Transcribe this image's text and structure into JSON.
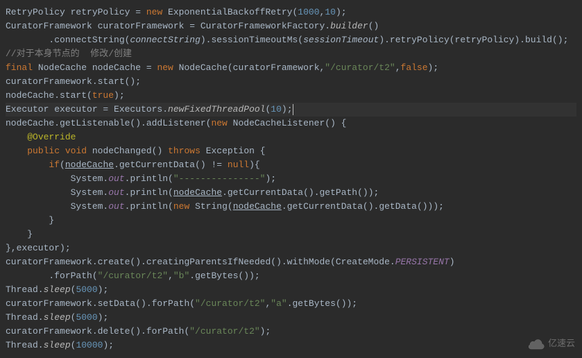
{
  "code": {
    "l1": {
      "t1": "RetryPolicy retryPolicy = ",
      "kw_new": "new",
      "t2": " ExponentialBackoffRetry(",
      "n1": "1000",
      "comma": ",",
      "n2": "10",
      "t3": ");"
    },
    "l2": {
      "t1": "CuratorFramework curatorFramework = CuratorFrameworkFactory.",
      "m1": "builder",
      "t2": "()"
    },
    "l3": {
      "indent": "        ",
      "t1": ".connectString(",
      "p1": "connectString",
      "t2": ").sessionTimeoutMs(",
      "p2": "sessionTimeout",
      "t3": ").retryPolicy(retryPolicy).build();"
    },
    "l4": {
      "c": "//对于本身节点的  修改/创建"
    },
    "l5": {
      "kw_final": "final",
      "t1": " NodeCache nodeCache = ",
      "kw_new": "new",
      "t2": " NodeCache(curatorFramework,",
      "s1": "\"/curator/t2\"",
      "t3": ",",
      "kw_false": "false",
      "t4": ");"
    },
    "l6": {
      "t1": "curatorFramework.start();"
    },
    "l7": {
      "t1": "nodeCache.start(",
      "kw_true": "true",
      "t2": ");"
    },
    "l8": {
      "t1": "Executor executor = Executors.",
      "m1": "newFixedThreadPool",
      "t2": "(",
      "n1": "10",
      "t3": ");"
    },
    "l9": {
      "t1": "nodeCache.getListenable().addListener(",
      "kw_new": "new",
      "t2": " NodeCacheListener() {"
    },
    "l10": {
      "indent": "    ",
      "ann": "@Override"
    },
    "l11": {
      "indent": "    ",
      "kw_pub": "public",
      "sp": " ",
      "kw_void": "void",
      "t1": " nodeChanged() ",
      "kw_throws": "throws",
      "t2": " Exception {"
    },
    "l12": {
      "indent": "        ",
      "kw_if": "if",
      "t1": "(",
      "u1": "nodeCache",
      "t2": ".getCurrentData() != ",
      "kw_null": "null",
      "t3": "){"
    },
    "l13": {
      "indent": "            ",
      "t1": "System.",
      "f1": "out",
      "t2": ".println(",
      "s1": "\"---------------\"",
      "t3": ");"
    },
    "l14": {
      "indent": "            ",
      "t1": "System.",
      "f1": "out",
      "t2": ".println(",
      "u1": "nodeCache",
      "t3": ".getCurrentData().getPath());"
    },
    "l15": {
      "indent": "            ",
      "t1": "System.",
      "f1": "out",
      "t2": ".println(",
      "kw_new": "new",
      "t3": " String(",
      "u1": "nodeCache",
      "t4": ".getCurrentData().getData()));"
    },
    "l16": {
      "indent": "        ",
      "t1": "}"
    },
    "l17": {
      "indent": "    ",
      "t1": "}"
    },
    "l18": {
      "t1": "},executor);"
    },
    "l19": {
      "t1": "curatorFramework.create().creatingParentsIfNeeded().withMode(CreateMode.",
      "f1": "PERSISTENT",
      "t2": ")"
    },
    "l20": {
      "indent": "        ",
      "t1": ".forPath(",
      "s1": "\"/curator/t2\"",
      "t2": ",",
      "s2": "\"b\"",
      "t3": ".getBytes());"
    },
    "l21": {
      "t1": "Thread.",
      "m1": "sleep",
      "t2": "(",
      "n1": "5000",
      "t3": ");"
    },
    "l22": {
      "t1": "curatorFramework.setData().forPath(",
      "s1": "\"/curator/t2\"",
      "t2": ",",
      "s2": "\"a\"",
      "t3": ".getBytes());"
    },
    "l23": {
      "t1": "Thread.",
      "m1": "sleep",
      "t2": "(",
      "n1": "5000",
      "t3": ");"
    },
    "l24": {
      "t1": "curatorFramework.delete().forPath(",
      "s1": "\"/curator/t2\"",
      "t2": ");"
    },
    "l25": {
      "t1": "Thread.",
      "m1": "sleep",
      "t2": "(",
      "n1": "10000",
      "t3": ");"
    }
  },
  "watermark": {
    "text": "亿速云"
  }
}
